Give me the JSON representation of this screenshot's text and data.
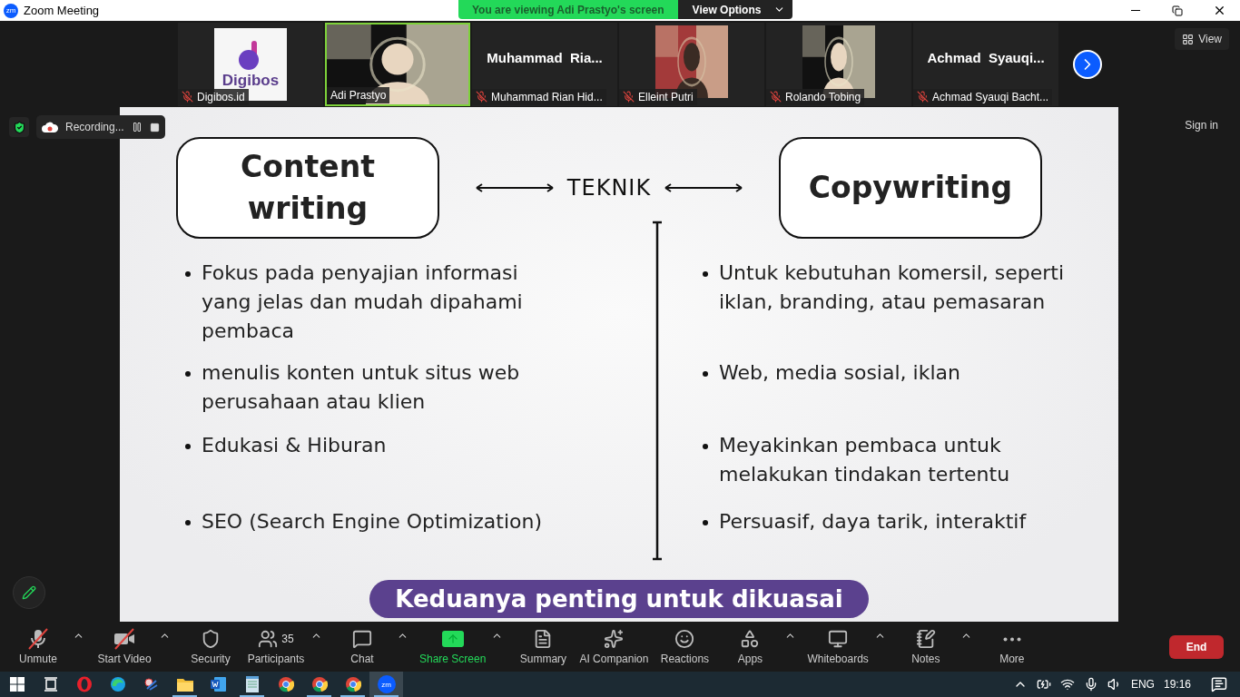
{
  "window": {
    "title": "Zoom Meeting",
    "badge": "zm"
  },
  "share_banner": {
    "text": "You are viewing Adi Prastyo's screen",
    "options": "View Options"
  },
  "view_button": "View",
  "participants": [
    {
      "name": "Digibos.id",
      "kind": "logo",
      "logo_text": "Digibos",
      "muted": true,
      "speaking": false
    },
    {
      "name": "Adi Prastyo",
      "kind": "picture",
      "muted": false,
      "speaking": true
    },
    {
      "name": "Muhammad Rian Hid...",
      "kind": "name",
      "display": "Muhammad  Ria...",
      "muted": true,
      "speaking": false
    },
    {
      "name": "Elleint Putri",
      "kind": "picture",
      "muted": true,
      "speaking": false
    },
    {
      "name": "Rolando Tobing",
      "kind": "picture",
      "muted": true,
      "speaking": false
    },
    {
      "name": "Achmad Syauqi Bacht...",
      "kind": "name",
      "display": "Achmad  Syauqi...",
      "muted": true,
      "speaking": false
    }
  ],
  "recording": {
    "label": "Recording..."
  },
  "sign_in": "Sign in",
  "slide": {
    "left_title": "Content writing",
    "center": "TEKNIK",
    "right_title": "Copywriting",
    "rows": [
      {
        "left": "Fokus pada penyajian informasi yang jelas dan mudah dipahami pembaca",
        "right": "Untuk kebutuhan komersil, seperti iklan, branding, atau pemasaran"
      },
      {
        "left": "menulis konten untuk situs web perusahaan atau klien",
        "right": "Web, media sosial, iklan"
      },
      {
        "left": "Edukasi & Hiburan",
        "right": "Meyakinkan pembaca untuk melakukan tindakan tertentu"
      },
      {
        "left": "SEO (Search Engine Optimization)",
        "right": "Persuasif, daya tarik, interaktif"
      }
    ],
    "banner": "Keduanya penting untuk dikuasai"
  },
  "toolbar": [
    {
      "label": "Unmute",
      "kind": "mic",
      "off": true,
      "caret": true
    },
    {
      "label": "Start Video",
      "kind": "video",
      "off": true,
      "caret": true
    },
    {
      "label": "Security",
      "kind": "security",
      "caret": false
    },
    {
      "label": "Participants",
      "kind": "participants",
      "count": "35",
      "caret": true
    },
    {
      "label": "Chat",
      "kind": "chat",
      "caret": true
    },
    {
      "label": "Share Screen",
      "kind": "share",
      "caret": true
    },
    {
      "label": "Summary",
      "kind": "summary",
      "caret": false
    },
    {
      "label": "AI Companion",
      "kind": "ai",
      "caret": false
    },
    {
      "label": "Reactions",
      "kind": "reactions",
      "caret": false
    },
    {
      "label": "Apps",
      "kind": "apps",
      "caret": true
    },
    {
      "label": "Whiteboards",
      "kind": "whiteboards",
      "caret": true
    },
    {
      "label": "Notes",
      "kind": "notes",
      "caret": true
    },
    {
      "label": "More",
      "kind": "more",
      "caret": false
    }
  ],
  "end_button": "End",
  "taskbar": {
    "apps": [
      {
        "kind": "windows",
        "running": false,
        "active": false
      },
      {
        "kind": "taskview",
        "running": false,
        "active": false
      },
      {
        "kind": "opera",
        "running": false,
        "active": false
      },
      {
        "kind": "edge",
        "running": false,
        "active": false
      },
      {
        "kind": "snip",
        "running": false,
        "active": false
      },
      {
        "kind": "files",
        "running": true,
        "active": false
      },
      {
        "kind": "word",
        "running": false,
        "active": false
      },
      {
        "kind": "notepad",
        "running": true,
        "active": false
      },
      {
        "kind": "chrome",
        "running": false,
        "active": false
      },
      {
        "kind": "chrome",
        "running": true,
        "active": false
      },
      {
        "kind": "chrome",
        "running": true,
        "active": false
      },
      {
        "kind": "zoom",
        "label": "zm",
        "running": true,
        "active": true
      }
    ],
    "language": "ENG",
    "time": "19:16"
  }
}
